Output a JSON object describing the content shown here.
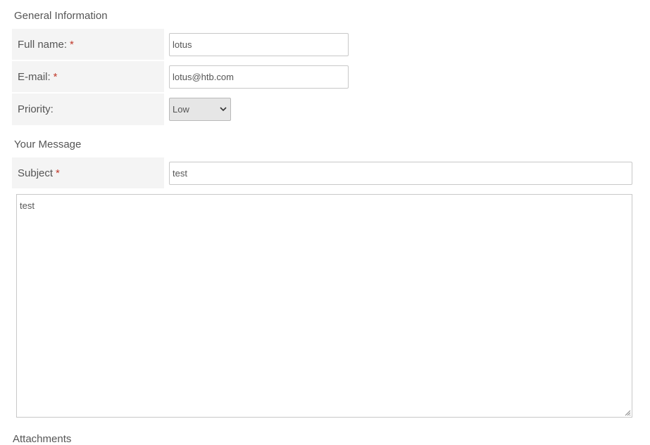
{
  "general": {
    "title": "General Information",
    "full_name": {
      "label": "Full name:",
      "required_mark": "*",
      "value": "lotus"
    },
    "email": {
      "label": "E-mail:",
      "required_mark": "*",
      "value": "lotus@htb.com"
    },
    "priority": {
      "label": "Priority:",
      "selected": "Low"
    }
  },
  "message": {
    "title": "Your Message",
    "subject": {
      "label": "Subject",
      "required_mark": "*",
      "value": "test"
    },
    "body": "test"
  },
  "attachments": {
    "title": "Attachments"
  },
  "colors": {
    "required": "#c0392b",
    "label_bg": "#f4f4f4"
  }
}
